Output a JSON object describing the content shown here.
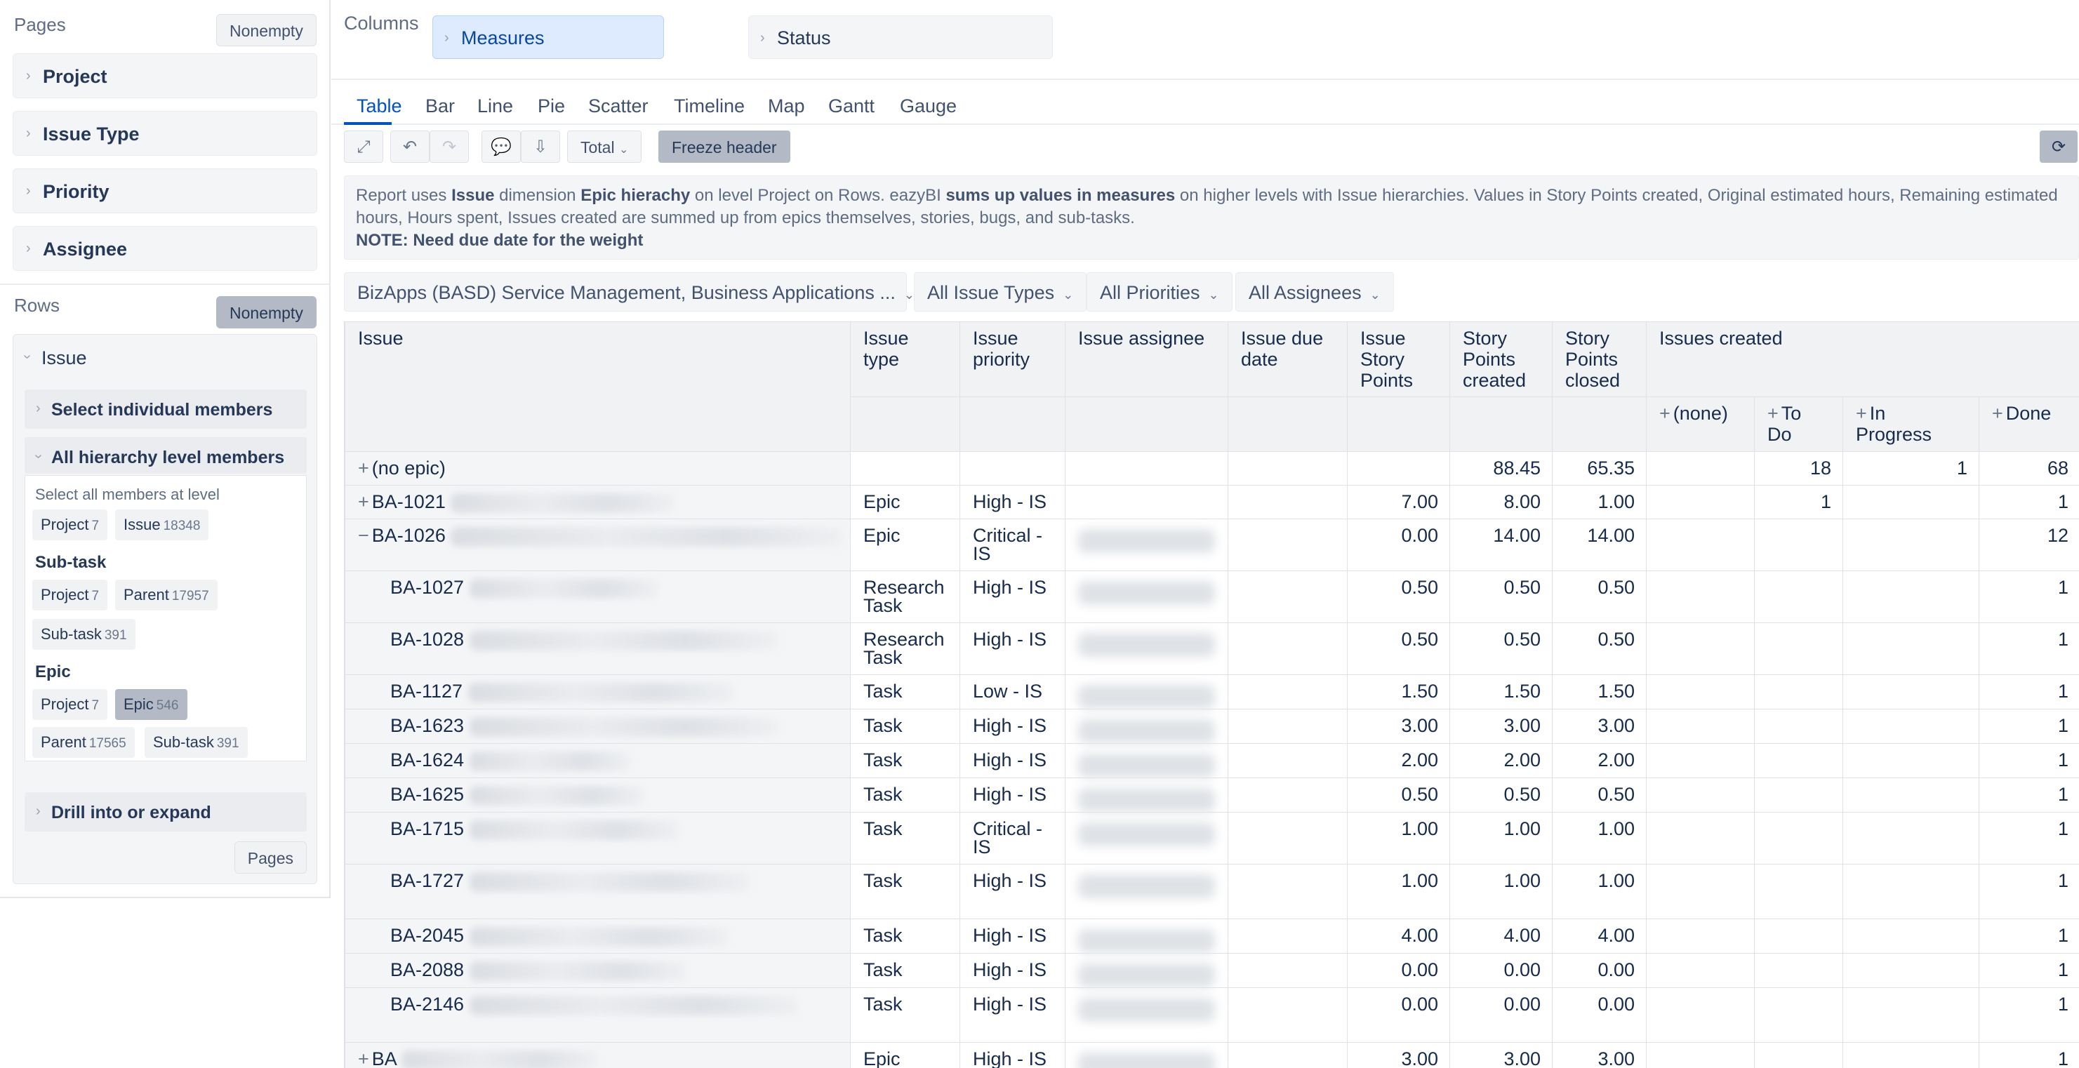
{
  "sidebar": {
    "pages_title": "Pages",
    "pages_nonempty": "Nonempty",
    "page_dims": [
      "Project",
      "Issue Type",
      "Priority",
      "Assignee"
    ],
    "rows_title": "Rows",
    "rows_nonempty": "Nonempty",
    "issue_dim": "Issue",
    "select_individual": "Select individual members",
    "all_hierarchy": "All hierarchy level members",
    "select_all_text": "Select all members at level",
    "level_chips_top": [
      {
        "label": "Project",
        "count": "7"
      },
      {
        "label": "Issue",
        "count": "18348"
      }
    ],
    "subtask_title": "Sub-task",
    "subtask_chips": [
      {
        "label": "Project",
        "count": "7"
      },
      {
        "label": "Parent",
        "count": "17957"
      },
      {
        "label": "Sub-task",
        "count": "391"
      }
    ],
    "epic_title": "Epic",
    "epic_chips": [
      {
        "label": "Project",
        "count": "7"
      },
      {
        "label": "Epic",
        "count": "546"
      },
      {
        "label": "Parent",
        "count": "17565"
      },
      {
        "label": "Sub-task",
        "count": "391"
      }
    ],
    "drill": "Drill into or expand",
    "pages_button": "Pages"
  },
  "columns": {
    "label": "Columns",
    "measures": "Measures",
    "status": "Status"
  },
  "tabs": [
    "Table",
    "Bar",
    "Line",
    "Pie",
    "Scatter",
    "Timeline",
    "Map",
    "Gantt",
    "Gauge"
  ],
  "active_tab": "Table",
  "toolbar": {
    "total": "Total",
    "freeze": "Freeze header"
  },
  "description": {
    "p1": "Report uses ",
    "b1": "Issue",
    "p2": " dimension ",
    "b2": "Epic hierachy",
    "p3": " on level Project on Rows. eazyBI ",
    "b3": "sums up values in measures",
    "p4": " on higher levels with Issue hierarchies. Values in Story Points created, Original estimated hours, Remaining estimated hours, Hours spent, Issues created are summed up from epics themselves, stories, bugs, and sub-tasks.",
    "note": "NOTE: Need due date for the weight"
  },
  "filters": [
    "BizApps (BASD) Service Management, Business Applications ...",
    "All Issue Types",
    "All Priorities",
    "All Assignees"
  ],
  "table": {
    "headers": {
      "issue": "Issue",
      "type": "Issue type",
      "priority": "Issue priority",
      "assignee": "Issue assignee",
      "due": "Issue due date",
      "sp": "Issue Story Points",
      "sp_created": "Story Points created",
      "sp_closed": "Story Points closed",
      "issues_created": "Issues created",
      "none": "(none)",
      "todo": "To Do",
      "inprog": "In Progress",
      "done": "Done"
    },
    "rows": [
      {
        "issue": "(no epic)",
        "indent": 0,
        "expander": "+",
        "type": "",
        "priority": "",
        "sp": "",
        "spc": "88.45",
        "spcl": "65.35",
        "none": "",
        "todo": "18",
        "inprog": "1",
        "done": "68"
      },
      {
        "issue": "BA-1021",
        "indent": 0,
        "expander": "+",
        "type": "Epic",
        "priority": "High - IS",
        "sp": "7.00",
        "spc": "8.00",
        "spcl": "1.00",
        "none": "",
        "todo": "1",
        "inprog": "",
        "done": "1"
      },
      {
        "issue": "BA-1026",
        "indent": 0,
        "expander": "−",
        "type": "Epic",
        "priority": "Critical - IS",
        "sp": "0.00",
        "spc": "14.00",
        "spcl": "14.00",
        "none": "",
        "todo": "",
        "inprog": "",
        "done": "12"
      },
      {
        "issue": "BA-1027",
        "indent": 1,
        "expander": "",
        "type": "Research Task",
        "priority": "High - IS",
        "sp": "0.50",
        "spc": "0.50",
        "spcl": "0.50",
        "none": "",
        "todo": "",
        "inprog": "",
        "done": "1"
      },
      {
        "issue": "BA-1028",
        "indent": 1,
        "expander": "",
        "type": "Research Task",
        "priority": "High - IS",
        "sp": "0.50",
        "spc": "0.50",
        "spcl": "0.50",
        "none": "",
        "todo": "",
        "inprog": "",
        "done": "1"
      },
      {
        "issue": "BA-1127",
        "indent": 1,
        "expander": "",
        "type": "Task",
        "priority": "Low - IS",
        "sp": "1.50",
        "spc": "1.50",
        "spcl": "1.50",
        "none": "",
        "todo": "",
        "inprog": "",
        "done": "1"
      },
      {
        "issue": "BA-1623",
        "indent": 1,
        "expander": "",
        "type": "Task",
        "priority": "High - IS",
        "sp": "3.00",
        "spc": "3.00",
        "spcl": "3.00",
        "none": "",
        "todo": "",
        "inprog": "",
        "done": "1"
      },
      {
        "issue": "BA-1624",
        "indent": 1,
        "expander": "",
        "type": "Task",
        "priority": "High - IS",
        "sp": "2.00",
        "spc": "2.00",
        "spcl": "2.00",
        "none": "",
        "todo": "",
        "inprog": "",
        "done": "1"
      },
      {
        "issue": "BA-1625",
        "indent": 1,
        "expander": "",
        "type": "Task",
        "priority": "High - IS",
        "sp": "0.50",
        "spc": "0.50",
        "spcl": "0.50",
        "none": "",
        "todo": "",
        "inprog": "",
        "done": "1"
      },
      {
        "issue": "BA-1715",
        "indent": 1,
        "expander": "",
        "type": "Task",
        "priority": "Critical - IS",
        "sp": "1.00",
        "spc": "1.00",
        "spcl": "1.00",
        "none": "",
        "todo": "",
        "inprog": "",
        "done": "1"
      },
      {
        "issue": "BA-1727",
        "indent": 1,
        "expander": "",
        "type": "Task",
        "priority": "High - IS",
        "sp": "1.00",
        "spc": "1.00",
        "spcl": "1.00",
        "none": "",
        "todo": "",
        "inprog": "",
        "done": "1"
      },
      {
        "issue": "BA-2045",
        "indent": 1,
        "expander": "",
        "type": "Task",
        "priority": "High - IS",
        "sp": "4.00",
        "spc": "4.00",
        "spcl": "4.00",
        "none": "",
        "todo": "",
        "inprog": "",
        "done": "1"
      },
      {
        "issue": "BA-2088",
        "indent": 1,
        "expander": "",
        "type": "Task",
        "priority": "High - IS",
        "sp": "0.00",
        "spc": "0.00",
        "spcl": "0.00",
        "none": "",
        "todo": "",
        "inprog": "",
        "done": "1"
      },
      {
        "issue": "BA-2146",
        "indent": 1,
        "expander": "",
        "type": "Task",
        "priority": "High - IS",
        "sp": "0.00",
        "spc": "0.00",
        "spcl": "0.00",
        "none": "",
        "todo": "",
        "inprog": "",
        "done": "1"
      },
      {
        "issue": "BA",
        "indent": 0,
        "expander": "+",
        "type": "Epic",
        "priority": "High - IS",
        "sp": "3.00",
        "spc": "3.00",
        "spcl": "3.00",
        "none": "",
        "todo": "",
        "inprog": "",
        "done": "1"
      }
    ]
  }
}
